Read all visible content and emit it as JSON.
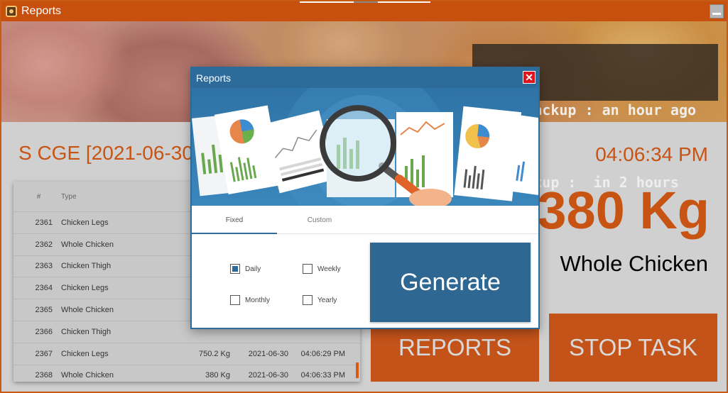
{
  "window": {
    "title": "Reports",
    "minimize_icon": "minimize-icon"
  },
  "backup": {
    "last_line": "Last Backup : an hour ago",
    "next_line": "   backup :  in 2 hours"
  },
  "header": {
    "title": "S CGE [2021-06-30",
    "time": "04:06:34 PM"
  },
  "scale": {
    "weight": "380 Kg",
    "product": "Whole Chicken"
  },
  "table": {
    "columns": [
      "#",
      "Type"
    ],
    "rows": [
      {
        "num": "2361",
        "type": "Chicken Legs",
        "weight": "",
        "date": "",
        "time": ""
      },
      {
        "num": "2362",
        "type": "Whole Chicken",
        "weight": "",
        "date": "",
        "time": ""
      },
      {
        "num": "2363",
        "type": "Chicken Thigh",
        "weight": "",
        "date": "",
        "time": ""
      },
      {
        "num": "2364",
        "type": "Chicken Legs",
        "weight": "",
        "date": "",
        "time": ""
      },
      {
        "num": "2365",
        "type": "Whole Chicken",
        "weight": "",
        "date": "",
        "time": ""
      },
      {
        "num": "2366",
        "type": "Chicken Thigh",
        "weight": "",
        "date": "",
        "time": ""
      },
      {
        "num": "2367",
        "type": "Chicken Legs",
        "weight": "750.2 Kg",
        "date": "2021-06-30",
        "time": "04:06:29 PM"
      },
      {
        "num": "2368",
        "type": "Whole Chicken",
        "weight": "380 Kg",
        "date": "2021-06-30",
        "time": "04:06:33 PM"
      }
    ]
  },
  "actions": {
    "reports": "REPORTS",
    "stop_task": "STOP TASK"
  },
  "modal": {
    "title": "Reports",
    "close_glyph": "✕",
    "tabs": [
      "Fixed",
      "Custom"
    ],
    "options": [
      {
        "label": "Daily",
        "checked": true
      },
      {
        "label": "Weekly",
        "checked": false
      },
      {
        "label": "Monthly",
        "checked": false
      },
      {
        "label": "Yearly",
        "checked": false
      }
    ],
    "generate_label": "Generate"
  },
  "colors": {
    "accent": "#c85414",
    "modal_blue": "#2d6b9b",
    "close_red": "#e0141d"
  }
}
